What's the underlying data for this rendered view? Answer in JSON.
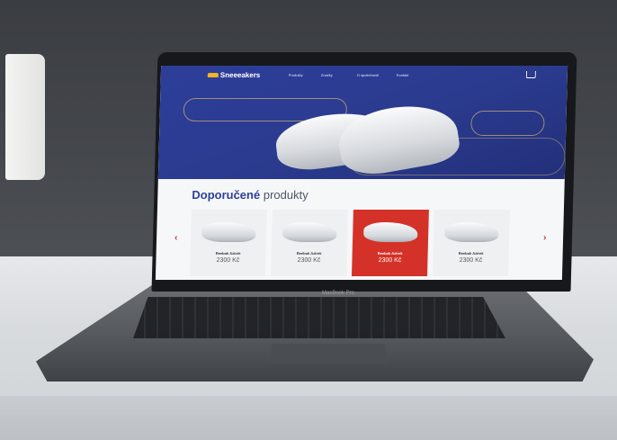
{
  "site": {
    "brand": "Sneeeakers",
    "nav": [
      "Produkty",
      "Značky",
      "O společnosti",
      "Kontakt"
    ],
    "section_title_bold": "Doporučené",
    "section_title_light": "produkty",
    "prev_arrow": "‹",
    "next_arrow": "›",
    "products": [
      {
        "name": "Reebok Aztrek",
        "price": "2300 Kč",
        "active": false
      },
      {
        "name": "Reebok Aztrek",
        "price": "2300 Kč",
        "active": false
      },
      {
        "name": "Reebok Aztrek",
        "price": "2300 Kč",
        "active": true
      },
      {
        "name": "Reebok Aztrek",
        "price": "2300 Kč",
        "active": false
      }
    ],
    "colors": {
      "hero": "#2d3e9a",
      "accent": "#d43228",
      "logo": "#f3b324"
    }
  },
  "laptop": {
    "model_label": "MacBook Pro"
  },
  "icons": [
    "cart-icon",
    "chevron-left-icon",
    "chevron-right-icon"
  ]
}
